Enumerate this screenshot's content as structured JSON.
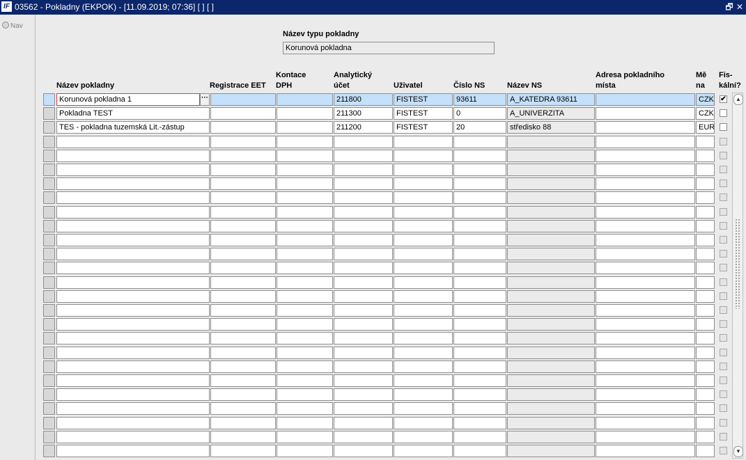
{
  "window": {
    "title": "03562 - Pokladny (EKPOK) - [11.09.2019; 07:36]  [ ]  [ ]",
    "app_icon": "IF",
    "restore_glyph": "🗗",
    "close_glyph": "✕"
  },
  "nav": {
    "label": "Nav"
  },
  "typ": {
    "label": "Název typu pokladny",
    "value": "Korunová pokladna"
  },
  "headers": {
    "nazev": "Název pokladny",
    "eet": "Registrace EET",
    "kontace": "Kontace\nDPH",
    "ucet": "Analytický\núčet",
    "uzivatel": "Uživatel",
    "cislo_ns": "Číslo NS",
    "nazev_ns": "Název NS",
    "adresa": "Adresa pokladního\nmísta",
    "mena": "Mě\nna",
    "fiskalni": "Fis-\nkální?"
  },
  "rows": [
    {
      "nazev": "Korunová pokladna 1",
      "eet": "",
      "kontace": "",
      "ucet": "211800",
      "uzivatel": "FISTEST",
      "cislo_ns": "93611",
      "nazev_ns": "A_KATEDRA 93611",
      "adresa": "",
      "mena": "CZK",
      "fiskalni": "✔"
    },
    {
      "nazev": "Pokladna TEST",
      "eet": "",
      "kontace": "",
      "ucet": "211300",
      "uzivatel": "FISTEST",
      "cislo_ns": "0",
      "nazev_ns": "A_UNIVERZITA",
      "adresa": "",
      "mena": "CZK",
      "fiskalni": ""
    },
    {
      "nazev": "TES - pokladna tuzemská Lit.-zástup",
      "eet": "",
      "kontace": "",
      "ucet": "211200",
      "uzivatel": "FISTEST",
      "cislo_ns": "20",
      "nazev_ns": "středisko 88",
      "adresa": "",
      "mena": "EUR",
      "fiskalni": ""
    }
  ],
  "empty_rows": 23,
  "lov_glyph": "···",
  "scroll": {
    "up_glyph": "▲",
    "down_glyph": "▼"
  }
}
